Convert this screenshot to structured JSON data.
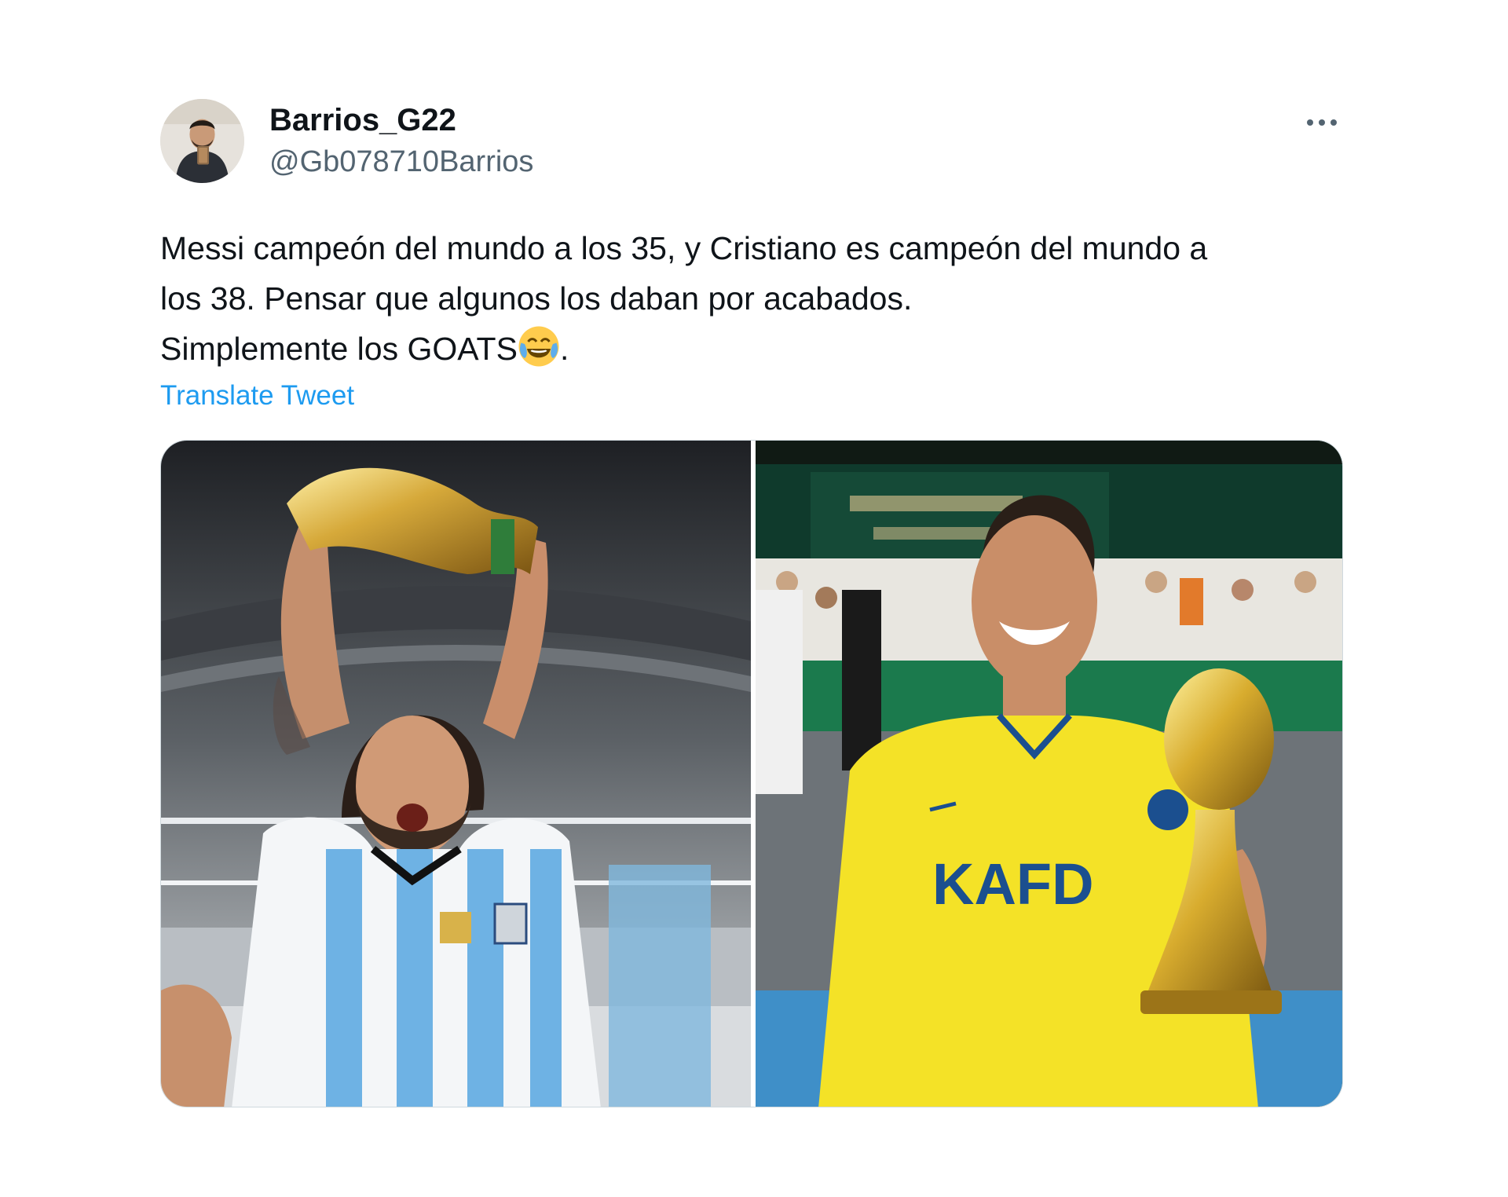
{
  "tweet": {
    "author": {
      "display_name": "Barrios_G22",
      "handle": "@Gb078710Barrios"
    },
    "text_lines": [
      "Messi campeón del mundo a los 35, y Cristiano es campeón del mundo a",
      "los 38. Pensar que algunos los daban por acabados.",
      "Simplemente los GOATS"
    ],
    "text_end": ".",
    "emoji": "face-with-tears-of-joy",
    "translate_label": "Translate Tweet",
    "more_icon": "more-horizontal-icon",
    "media": {
      "count": 2,
      "left_image": "messi-world-cup-trophy-photo",
      "right_image": "ronaldo-trophy-photo",
      "right_shirt_text": "KAFD"
    }
  },
  "colors": {
    "text": "#0f1419",
    "secondary": "#536471",
    "link": "#1d9bf0",
    "border": "#cfd9de"
  }
}
